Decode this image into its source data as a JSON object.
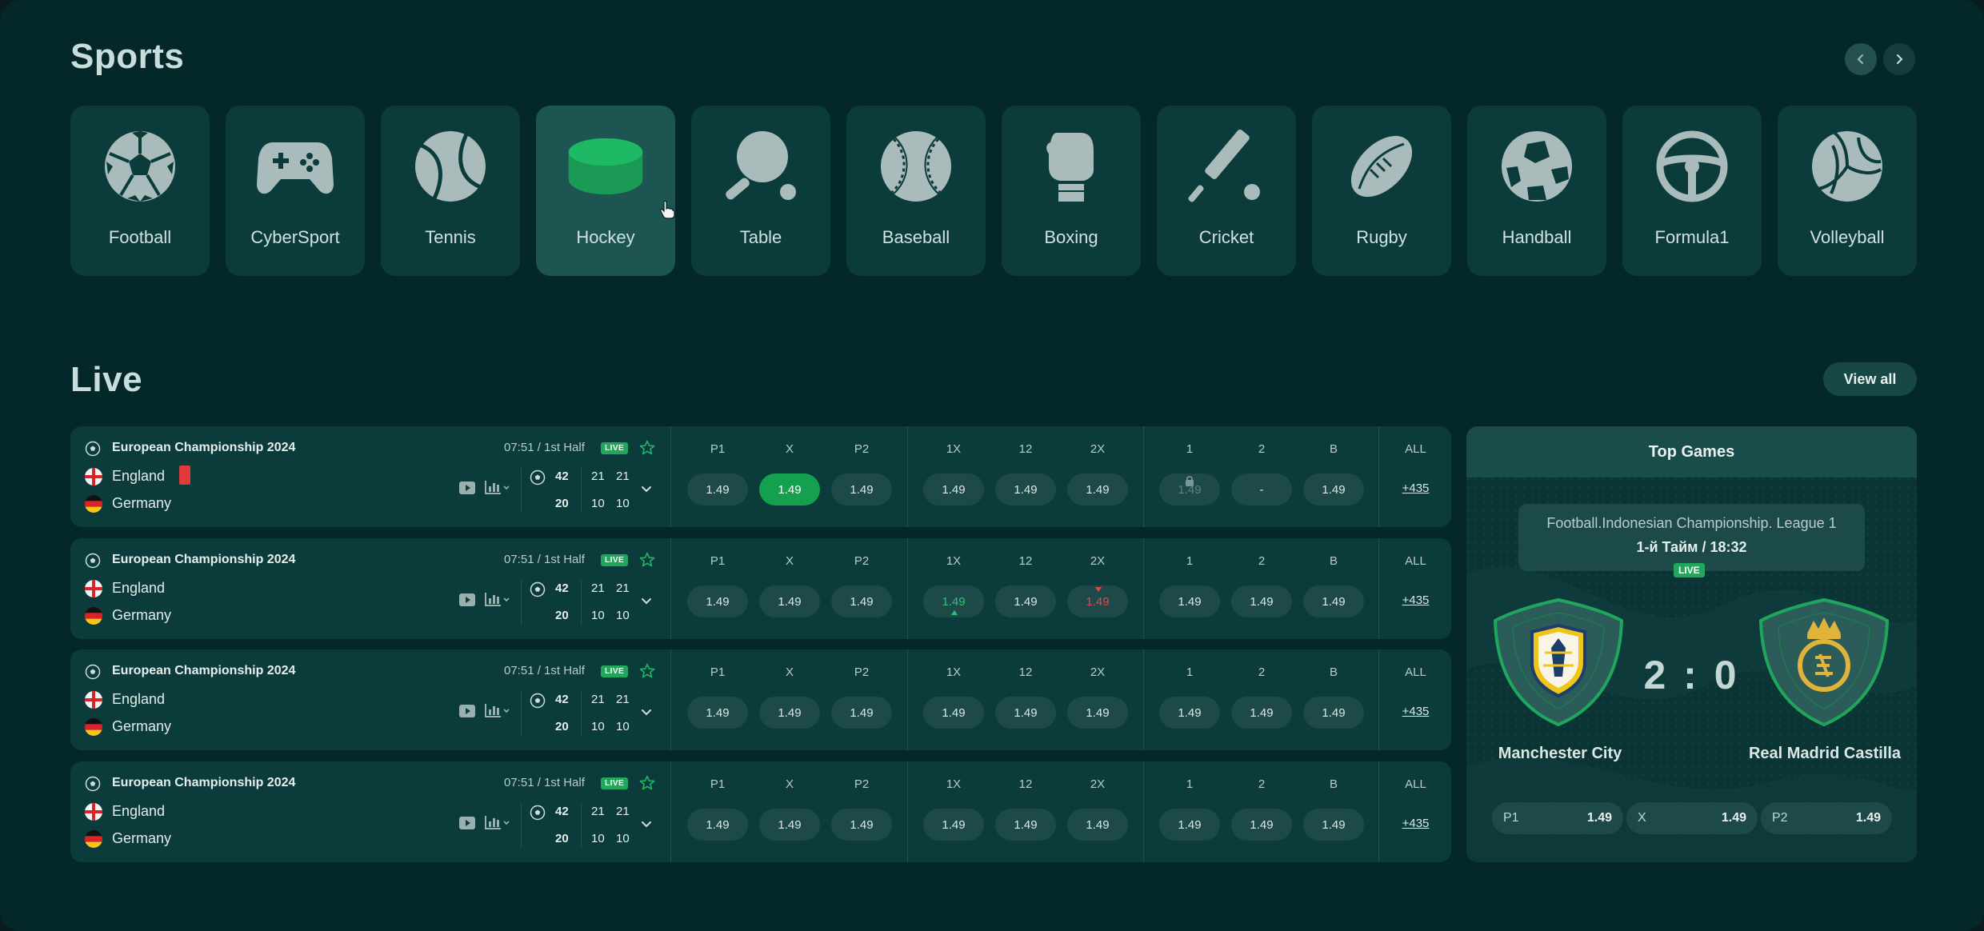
{
  "sports_section": {
    "title": "Sports",
    "nav": {
      "prev_icon": "chevron-left-icon",
      "next_icon": "chevron-right-icon"
    },
    "items": [
      {
        "label": "Football",
        "icon": "football-icon"
      },
      {
        "label": "CyberSport",
        "icon": "gamepad-icon"
      },
      {
        "label": "Tennis",
        "icon": "tennis-ball-icon"
      },
      {
        "label": "Hockey",
        "icon": "hockey-puck-icon",
        "active": true
      },
      {
        "label": "Table",
        "icon": "table-tennis-icon"
      },
      {
        "label": "Baseball",
        "icon": "baseball-icon"
      },
      {
        "label": "Boxing",
        "icon": "boxing-glove-icon"
      },
      {
        "label": "Cricket",
        "icon": "cricket-bat-icon"
      },
      {
        "label": "Rugby",
        "icon": "rugby-ball-icon"
      },
      {
        "label": "Handball",
        "icon": "handball-icon"
      },
      {
        "label": "Formula1",
        "icon": "steering-wheel-icon"
      },
      {
        "label": "Volleyball",
        "icon": "volleyball-icon"
      }
    ]
  },
  "live_section": {
    "title": "Live",
    "view_all": "View all",
    "odds_headers": {
      "group1": [
        "P1",
        "X",
        "P2"
      ],
      "group2": [
        "1X",
        "12",
        "2X"
      ],
      "group3": [
        "1",
        "2",
        "B"
      ],
      "all": "ALL"
    },
    "matches": [
      {
        "competition": "European Championship 2024",
        "time": "07:51 / 1st Half",
        "badge": "LIVE",
        "team1": "England",
        "team2": "Germany",
        "red_card": true,
        "score_main": [
          "42",
          "20"
        ],
        "score_p1": [
          "21",
          "10"
        ],
        "score_p2": [
          "21",
          "10"
        ],
        "odds1": [
          "1.49",
          "1.49",
          "1.49"
        ],
        "odds2": [
          "1.49",
          "1.49",
          "1.49"
        ],
        "odds3": [
          "1.49",
          "-",
          "1.49"
        ],
        "selected": "x",
        "locked": "b1",
        "all": "+435"
      },
      {
        "competition": "European Championship 2024",
        "time": "07:51 / 1st Half",
        "badge": "LIVE",
        "team1": "England",
        "team2": "Germany",
        "score_main": [
          "42",
          "20"
        ],
        "score_p1": [
          "21",
          "10"
        ],
        "score_p2": [
          "21",
          "10"
        ],
        "odds1": [
          "1.49",
          "1.49",
          "1.49"
        ],
        "odds2": [
          "1.49",
          "1.49",
          "1.49"
        ],
        "odds3": [
          "1.49",
          "1.49",
          "1.49"
        ],
        "trend_up": "1X",
        "trend_down": "2X",
        "all": "+435"
      },
      {
        "competition": "European Championship 2024",
        "time": "07:51 / 1st Half",
        "badge": "LIVE",
        "team1": "England",
        "team2": "Germany",
        "score_main": [
          "42",
          "20"
        ],
        "score_p1": [
          "21",
          "10"
        ],
        "score_p2": [
          "21",
          "10"
        ],
        "odds1": [
          "1.49",
          "1.49",
          "1.49"
        ],
        "odds2": [
          "1.49",
          "1.49",
          "1.49"
        ],
        "odds3": [
          "1.49",
          "1.49",
          "1.49"
        ],
        "all": "+435"
      },
      {
        "competition": "European Championship 2024",
        "time": "07:51 / 1st Half",
        "badge": "LIVE",
        "team1": "England",
        "team2": "Germany",
        "score_main": [
          "42",
          "20"
        ],
        "score_p1": [
          "21",
          "10"
        ],
        "score_p2": [
          "21",
          "10"
        ],
        "odds1": [
          "1.49",
          "1.49",
          "1.49"
        ],
        "odds2": [
          "1.49",
          "1.49",
          "1.49"
        ],
        "odds3": [
          "1.49",
          "1.49",
          "1.49"
        ],
        "all": "+435"
      }
    ]
  },
  "top_games": {
    "title": "Top Games",
    "league": "Football.Indonesian Championship. League 1",
    "period": "1-й Тайм / 18:32",
    "badge": "LIVE",
    "score": "2 : 0",
    "home": "Manchester City",
    "away": "Real Madrid Castilla",
    "odds": [
      {
        "label": "P1",
        "value": "1.49"
      },
      {
        "label": "X",
        "value": "1.49"
      },
      {
        "label": "P2",
        "value": "1.49"
      }
    ]
  },
  "colors": {
    "background": "#04272a",
    "card": "#0c3b3c",
    "active_tile": "#1c5552",
    "accent_green": "#1fb865",
    "odd_button": "#1d4a49",
    "trend_down": "#e04848"
  }
}
